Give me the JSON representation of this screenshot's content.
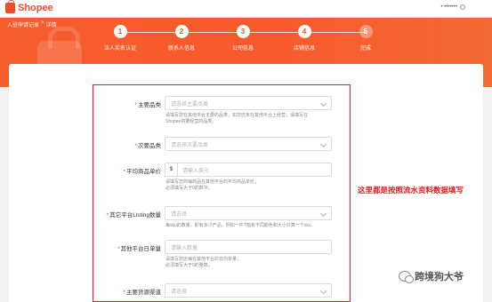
{
  "header": {
    "logo_text": "Shopee",
    "user_text": "• •••••••"
  },
  "breadcrumb": [
    "入驻申请记录",
    ">",
    "详情"
  ],
  "steps": [
    {
      "num": "1",
      "label": "法人实名认证"
    },
    {
      "num": "2",
      "label": "联系人信息"
    },
    {
      "num": "3",
      "label": "公司信息"
    },
    {
      "num": "4",
      "label": "店铺信息"
    },
    {
      "num": "5",
      "label": "完成"
    }
  ],
  "form": {
    "main_category": {
      "label": "主要品类",
      "placeholder": "请选择主要品类",
      "hint1": "请填写您在其他平台主要的品类，如您还未在其他平台上经营，请填写在",
      "hint2": "Shopee将要经营的品类。"
    },
    "sub_category": {
      "label": "次要品类",
      "placeholder": "请选择次要品类"
    },
    "avg_price": {
      "label": "平均商品单价",
      "prefix": "$",
      "placeholder": "请输入美元",
      "hint1": "请填写您商铺商品在其他平台的平均商品单价；",
      "hint2": "必须填写大于0的数字。"
    },
    "listing_count": {
      "label": "其它平台Listing数量",
      "placeholder": "请选择",
      "hint1": "每sku的数量，即有多少产品。例如一件T恤有不同颜色和大小只算一个sku"
    },
    "daily_orders": {
      "label": "其他平台日单量",
      "placeholder": "请输入数量",
      "hint1": "请填写您店铺在其他平台的日均单量；",
      "hint2": "必须填写大于0的整数。"
    },
    "main_channel": {
      "label": "主要货源渠道",
      "placeholder": "请选择"
    }
  },
  "annotation": "这里都是按照流水资料数据填写",
  "watermark": "跨境狗大爷",
  "colors": {
    "brand": "#ee4d2d",
    "annotation": "#e02020"
  }
}
